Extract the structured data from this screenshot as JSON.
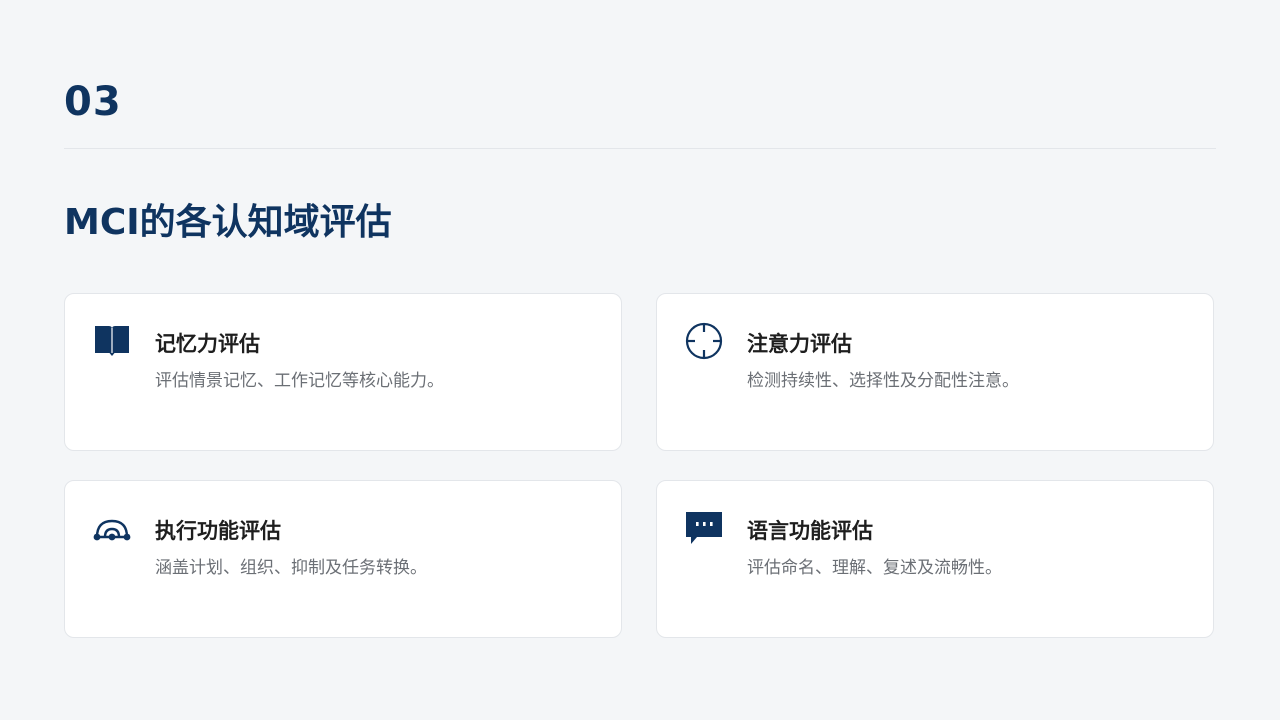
{
  "slide": {
    "number": "03",
    "title": "MCI的各认知域评估"
  },
  "theme": {
    "accent": "#0f3460",
    "background": "#f4f6f8",
    "card_background": "#ffffff",
    "title_text": "#1e1e1e",
    "desc_text": "#6b6f75"
  },
  "cards": [
    {
      "icon": "book-icon",
      "title": "记忆力评估",
      "description": "评估情景记忆、工作记忆等核心能力。"
    },
    {
      "icon": "crosshair-icon",
      "title": "注意力评估",
      "description": "检测持续性、选择性及分配性注意。"
    },
    {
      "icon": "network-icon",
      "title": "执行功能评估",
      "description": "涵盖计划、组织、抑制及任务转换。"
    },
    {
      "icon": "chat-bubble-icon",
      "title": "语言功能评估",
      "description": "评估命名、理解、复述及流畅性。"
    }
  ]
}
